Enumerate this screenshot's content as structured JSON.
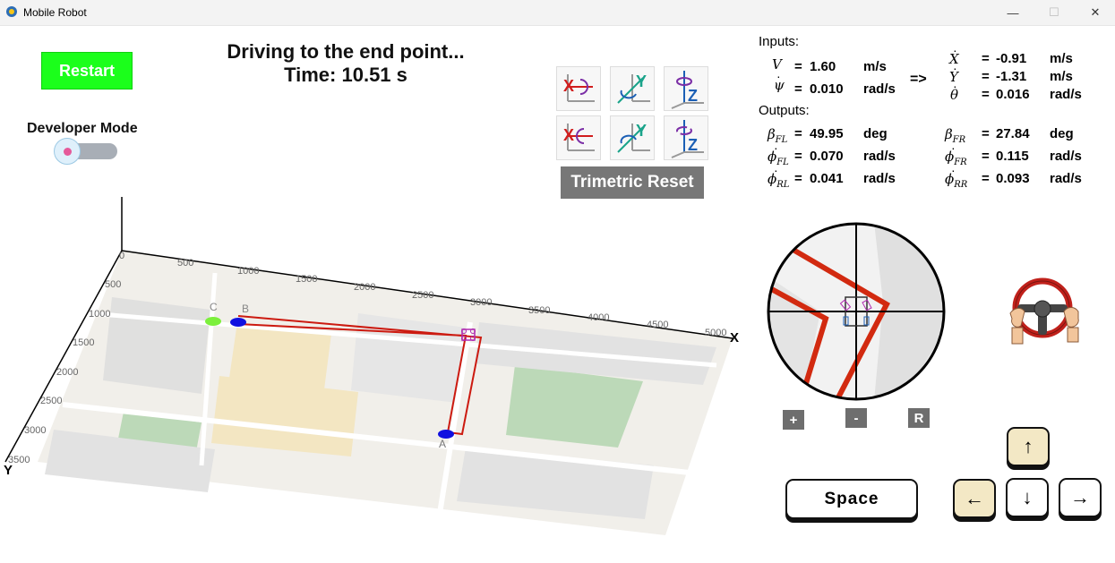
{
  "window": {
    "title": "Mobile Robot",
    "minimize": "—",
    "maximize": "☐",
    "close": "✕"
  },
  "controls": {
    "restart_label": "Restart",
    "developer_mode_label": "Developer Mode",
    "developer_mode_on": false,
    "trimetric_reset_label": "Trimetric Reset"
  },
  "status": {
    "line1": "Driving to the end point...",
    "line2": "Time: 10.51 s"
  },
  "view_buttons": [
    {
      "axis": "X",
      "color": "#d11d1d",
      "rotation": "positive"
    },
    {
      "axis": "Y",
      "color": "#1aa38a",
      "rotation": "positive"
    },
    {
      "axis": "Z",
      "color": "#1b5fb5",
      "rotation": "positive"
    },
    {
      "axis": "X",
      "color": "#d11d1d",
      "rotation": "negative"
    },
    {
      "axis": "Y",
      "color": "#1aa38a",
      "rotation": "negative"
    },
    {
      "axis": "Z",
      "color": "#1b5fb5",
      "rotation": "negative"
    }
  ],
  "readout": {
    "inputs_label": "Inputs:",
    "outputs_label": "Outputs:",
    "arrow": "=>",
    "eq": "=",
    "V": {
      "symbol": "V",
      "value": "1.60",
      "unit": "m/s"
    },
    "psi_dot": {
      "symbol": "ψ",
      "value": "0.010",
      "unit": "rad/s"
    },
    "X_dot": {
      "symbol": "X",
      "value": "-0.91",
      "unit": "m/s"
    },
    "Y_dot": {
      "symbol": "Y",
      "value": "-1.31",
      "unit": "m/s"
    },
    "theta_dot": {
      "symbol": "θ",
      "value": "0.016",
      "unit": "rad/s"
    },
    "beta_FL": {
      "symbol": "β",
      "sub": "FL",
      "value": "49.95",
      "unit": "deg"
    },
    "beta_FR": {
      "symbol": "β",
      "sub": "FR",
      "value": "27.84",
      "unit": "deg"
    },
    "phi_FL": {
      "symbol": "ϕ",
      "sub": "FL",
      "value": "0.070",
      "unit": "rad/s"
    },
    "phi_FR": {
      "symbol": "ϕ",
      "sub": "FR",
      "value": "0.115",
      "unit": "rad/s"
    },
    "phi_RL": {
      "symbol": "ϕ",
      "sub": "RL",
      "value": "0.041",
      "unit": "rad/s"
    },
    "phi_RR": {
      "symbol": "ϕ",
      "sub": "RR",
      "value": "0.093",
      "unit": "rad/s"
    }
  },
  "plot": {
    "x_axis_label": "X",
    "y_axis_label": "Y",
    "x_ticks": [
      "0",
      "500",
      "1000",
      "1500",
      "2000",
      "2500",
      "3000",
      "3500",
      "4000",
      "4500",
      "5000"
    ],
    "y_ticks": [
      "500",
      "1000",
      "1500",
      "2000",
      "2500",
      "3000",
      "3500"
    ],
    "point_labels": {
      "A": "A",
      "B": "B",
      "C": "C"
    },
    "colors": {
      "path": "#cc1a10",
      "start": "#1010e0",
      "end": "#7cf03c"
    }
  },
  "minimap": {
    "zoom_in": "+",
    "zoom_out": "-",
    "reset": "R"
  },
  "keys": {
    "space": "Space",
    "up": "↑",
    "left": "←",
    "down": "↓",
    "right": "→",
    "active": [
      "up",
      "left"
    ]
  }
}
